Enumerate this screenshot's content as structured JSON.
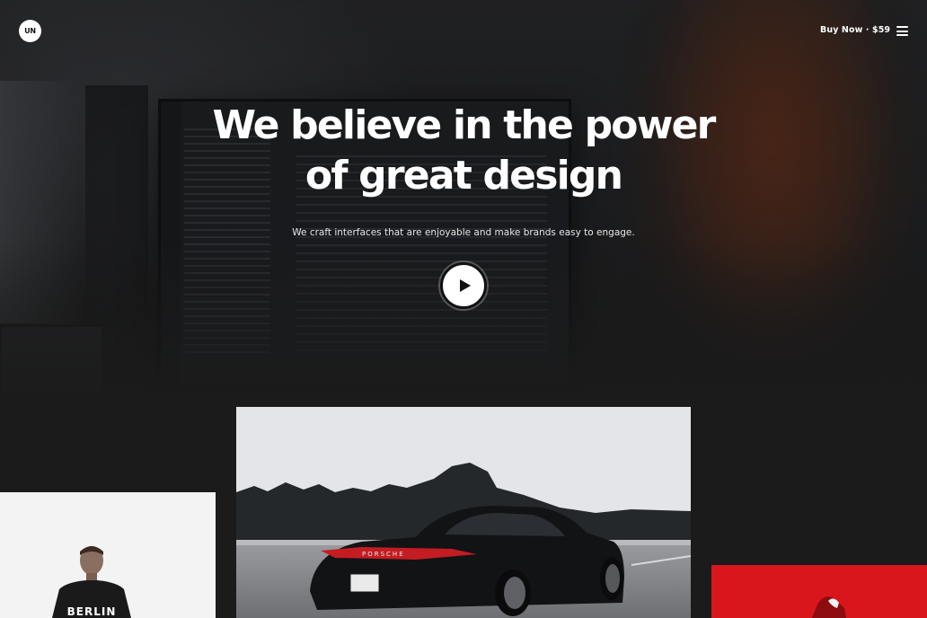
{
  "header": {
    "logo_text": "UN",
    "buy_label": "Buy Now · $59",
    "menu_icon": "menu-icon"
  },
  "hero": {
    "headline": "We believe in the power of great design",
    "subheadline": "We craft interfaces that are enjoyable and make brands easy to engage.",
    "play_icon": "play-icon"
  },
  "gallery": {
    "person_shirt_text": "BERLIN",
    "car_brand_text": "PORSCHE"
  },
  "colors": {
    "background": "#1b1b1b",
    "accent_red": "#d8161c",
    "text": "#ffffff"
  }
}
